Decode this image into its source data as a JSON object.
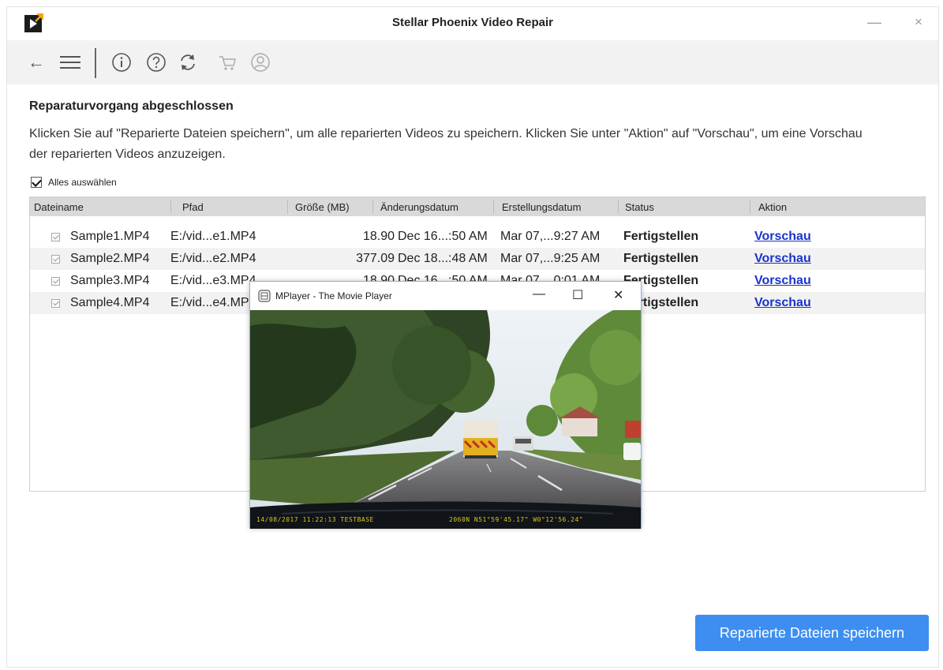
{
  "window": {
    "title": "Stellar Phoenix Video Repair",
    "minimize_label": "—",
    "close_label": "×"
  },
  "toolbar": {
    "back_label": "←",
    "icons": [
      "back-arrow-icon",
      "menu-icon",
      "info-icon",
      "help-icon",
      "refresh-icon",
      "cart-icon",
      "user-icon"
    ]
  },
  "main": {
    "heading": "Reparaturvorgang abgeschlossen",
    "description": "Klicken Sie auf \"Reparierte Dateien speichern\", um alle reparierten Videos zu speichern. Klicken Sie unter \"Aktion\" auf \"Vorschau\", um eine Vorschau der reparierten Videos anzuzeigen.",
    "select_all_label": "Alles auswählen",
    "select_all_checked": true
  },
  "table": {
    "headers": [
      "Dateiname",
      "Pfad",
      "Größe (MB)",
      "Änderungsdatum",
      "Erstellungsdatum",
      "Status",
      "Aktion"
    ],
    "rows": [
      {
        "name": "Sample1.MP4",
        "path": "E:/vid...e1.MP4",
        "size": "18.90",
        "modified": "Dec 16...:50 AM",
        "created": "Mar 07,...9:27 AM",
        "status": "Fertigstellen",
        "action": "Vorschau"
      },
      {
        "name": "Sample2.MP4",
        "path": "E:/vid...e2.MP4",
        "size": "377.09",
        "modified": "Dec 18...:48 AM",
        "created": "Mar 07,...9:25 AM",
        "status": "Fertigstellen",
        "action": "Vorschau"
      },
      {
        "name": "Sample3.MP4",
        "path": "E:/vid...e3.MP4",
        "size": "18.90",
        "modified": "Dec 16...:50 AM",
        "created": "Mar 07,...0:01 AM",
        "status": "Fertigstellen",
        "action": "Vorschau"
      },
      {
        "name": "Sample4.MP4",
        "path": "E:/vid...e4.MP4",
        "size": "",
        "modified": "",
        "created": "",
        "status": "Fertigstellen",
        "action": "Vorschau"
      }
    ]
  },
  "footer": {
    "save_label": "Reparierte Dateien speichern"
  },
  "mplayer": {
    "title": "MPlayer - The Movie Player",
    "minimize_label": "—",
    "maximize_label": "☐",
    "close_label": "✕",
    "osd_left": "14/08/2017 11:22:13 TESTBASE",
    "osd_right": "2060N N51°59'45.17\" W0°12'56.24\""
  },
  "colors": {
    "accent": "#3d8ef0",
    "link": "#1a33cc",
    "toolbar_bg": "#f2f2f2",
    "header_bg": "#d9d9d9"
  }
}
